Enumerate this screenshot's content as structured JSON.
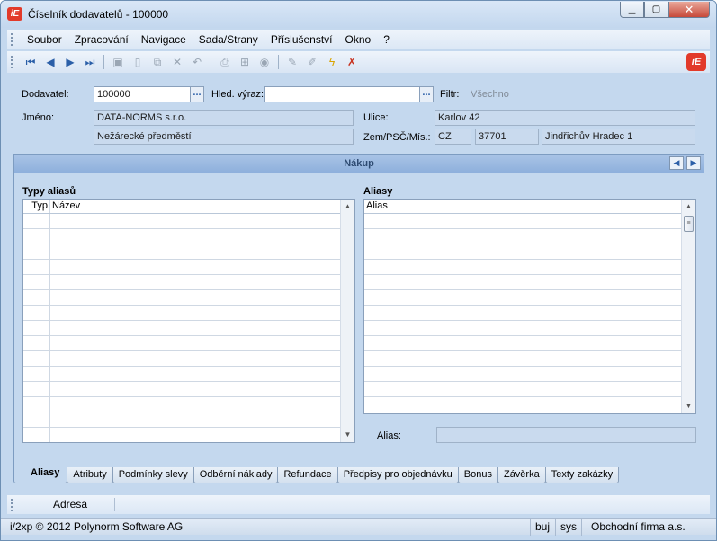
{
  "window": {
    "title": "Číselník dodavatelů - 100000",
    "app_icon": "i2-logo",
    "minimize_label": "—",
    "maximize_label": "□",
    "close_label": "✕"
  },
  "menu": [
    "Soubor",
    "Zpracování",
    "Navigace",
    "Sada/Strany",
    "Příslušenství",
    "Okno",
    "?"
  ],
  "header": {
    "supplier_label": "Dodavatel:",
    "supplier_value": "100000",
    "search_label": "Hled. výraz:",
    "search_value": "",
    "filter_label": "Filtr:",
    "filter_value": "Všechno",
    "name_label": "Jméno:",
    "name_line1": "DATA-NORMS s.r.o.",
    "name_line2": "Nežárecké předměstí",
    "street_label": "Ulice:",
    "street_value": "Karlov 42",
    "country_label": "Zem/PSČ/Mís.:",
    "country_value": "CZ",
    "zip_value": "37701",
    "city_value": "Jindřichův Hradec 1",
    "ellipsis": "..."
  },
  "section": {
    "title": "Nákup",
    "alias_types_title": "Typy aliasů",
    "alias_types_columns": [
      "Typ",
      "Název"
    ],
    "aliases_title": "Aliasy",
    "aliases_column": "Alias",
    "alias_field_label": "Alias:",
    "alias_field_value": ""
  },
  "tabs": [
    "Aliasy",
    "Atributy",
    "Podmínky slevy",
    "Odběrní náklady",
    "Refundace",
    "Předpisy pro objednávku",
    "Bonus",
    "Závěrka",
    "Texty zakázky"
  ],
  "active_tab": "Aliasy",
  "bottom_bar": {
    "address_button": "Adresa"
  },
  "status": {
    "copyright": "i/2xp © 2012 Polynorm Software AG",
    "user": "buj",
    "system": "sys",
    "company": "Obchodní firma a.s."
  },
  "colors": {
    "window_bg": "#c4d8ee",
    "section_header": "#8eb0dc",
    "brand_red": "#e23a2a"
  }
}
